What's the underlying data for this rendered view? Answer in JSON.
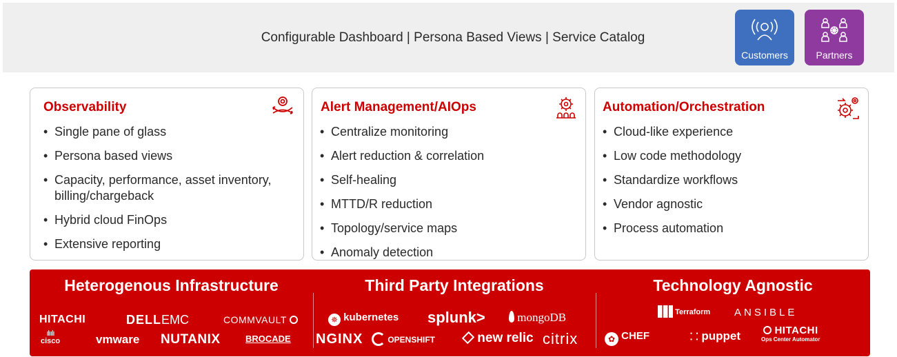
{
  "banner": {
    "text": "Configurable Dashboard | Persona Based Views | Service Catalog"
  },
  "personas": [
    {
      "label": "Customers",
      "color": "#3f6fbf",
      "icon": "person-broadcast-icon"
    },
    {
      "label": "Partners",
      "color": "#8e3a9e",
      "icon": "partner-network-icon"
    }
  ],
  "cards": [
    {
      "title": "Observability",
      "icon": "eye-cycle-icon",
      "items": [
        "Single pane of glass",
        "Persona based views",
        "Capacity, performance, asset inventory, billing/chargeback",
        "Hybrid cloud FinOps",
        "Extensive reporting"
      ]
    },
    {
      "title": "Alert Management/AIOps",
      "icon": "gear-team-icon",
      "items": [
        "Centralize monitoring",
        "Alert reduction & correlation",
        "Self-healing",
        "MTTD/R reduction",
        "Topology/service maps",
        "Anomaly detection"
      ]
    },
    {
      "title": "Automation/Orchestration",
      "icon": "gear-automation-icon",
      "items": [
        "Cloud-like experience",
        "Low code methodology",
        "Standardize workflows",
        "Vendor agnostic",
        "Process automation"
      ]
    }
  ],
  "band": {
    "color": "#cc0000",
    "sections": [
      {
        "title": "Heterogenous Infrastructure",
        "logos": [
          "HITACHI",
          "DELL",
          "EMC",
          "COMMVAULT",
          "cisco",
          "vmware",
          "NUTANIX",
          "BROCADE"
        ]
      },
      {
        "title": "Third Party Integrations",
        "logos": [
          "kubernetes",
          "splunk>",
          "mongoDB",
          "NGINX",
          "OPENSHIFT",
          "new relic",
          "citrix"
        ]
      },
      {
        "title": "Technology Agnostic",
        "logos": [
          "Terraform",
          "ANSIBLE",
          "CHEF",
          "puppet",
          "HITACHI",
          "Ops Center Automator"
        ]
      }
    ]
  }
}
